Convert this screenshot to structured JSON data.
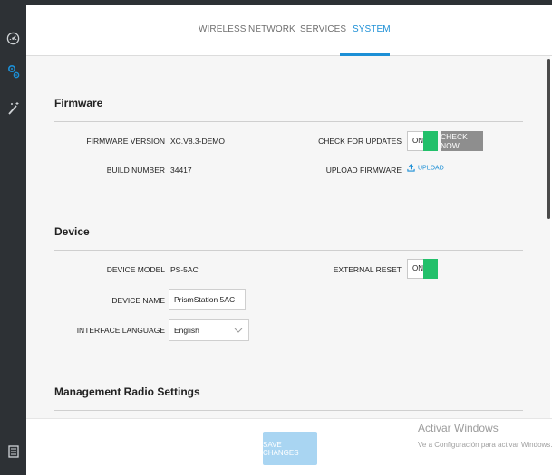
{
  "tabs": [
    {
      "label": "WIRELESS"
    },
    {
      "label": "NETWORK"
    },
    {
      "label": "SERVICES"
    },
    {
      "label": "SYSTEM"
    }
  ],
  "active_tab": "SYSTEM",
  "sidebar": {
    "items": [
      {
        "icon": "dashboard-icon"
      },
      {
        "icon": "settings-gears-icon"
      },
      {
        "icon": "magic-wand-icon"
      },
      {
        "icon": "log-document-icon"
      }
    ]
  },
  "firmware": {
    "title": "Firmware",
    "version_label": "FIRMWARE VERSION",
    "version_value": "XC.V8.3-DEMO",
    "build_label": "BUILD NUMBER",
    "build_value": "34417",
    "check_label": "CHECK FOR UPDATES",
    "check_toggle": "ON",
    "check_button": "CHECK NOW",
    "upload_label": "UPLOAD FIRMWARE",
    "upload_link": "UPLOAD"
  },
  "device": {
    "title": "Device",
    "model_label": "DEVICE MODEL",
    "model_value": "PS-5AC",
    "name_label": "DEVICE NAME",
    "name_value": "PrismStation 5AC",
    "language_label": "INTERFACE LANGUAGE",
    "language_value": "English",
    "reset_label": "EXTERNAL RESET",
    "reset_toggle": "ON"
  },
  "management": {
    "title": "Management Radio Settings"
  },
  "footer": {
    "save_label": "SAVE CHANGES"
  },
  "watermark": {
    "line1": "Activar Windows",
    "line2": "Ve a Configuración para activar Windows."
  },
  "colors": {
    "accent": "#1c8fd6",
    "toggle_on": "#22c06a",
    "sidebar": "#2d3135",
    "save_disabled": "#a9d5f2"
  }
}
